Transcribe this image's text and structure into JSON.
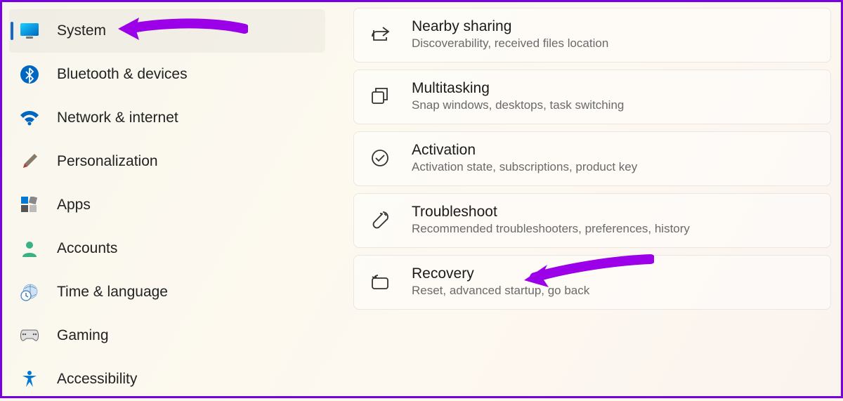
{
  "sidebar": {
    "items": [
      {
        "label": "System"
      },
      {
        "label": "Bluetooth & devices"
      },
      {
        "label": "Network & internet"
      },
      {
        "label": "Personalization"
      },
      {
        "label": "Apps"
      },
      {
        "label": "Accounts"
      },
      {
        "label": "Time & language"
      },
      {
        "label": "Gaming"
      },
      {
        "label": "Accessibility"
      }
    ]
  },
  "cards": [
    {
      "title": "Nearby sharing",
      "desc": "Discoverability, received files location"
    },
    {
      "title": "Multitasking",
      "desc": "Snap windows, desktops, task switching"
    },
    {
      "title": "Activation",
      "desc": "Activation state, subscriptions, product key"
    },
    {
      "title": "Troubleshoot",
      "desc": "Recommended troubleshooters, preferences, history"
    },
    {
      "title": "Recovery",
      "desc": "Reset, advanced startup, go back"
    }
  ],
  "annotations": {
    "arrow_color": "#9b00e8"
  }
}
